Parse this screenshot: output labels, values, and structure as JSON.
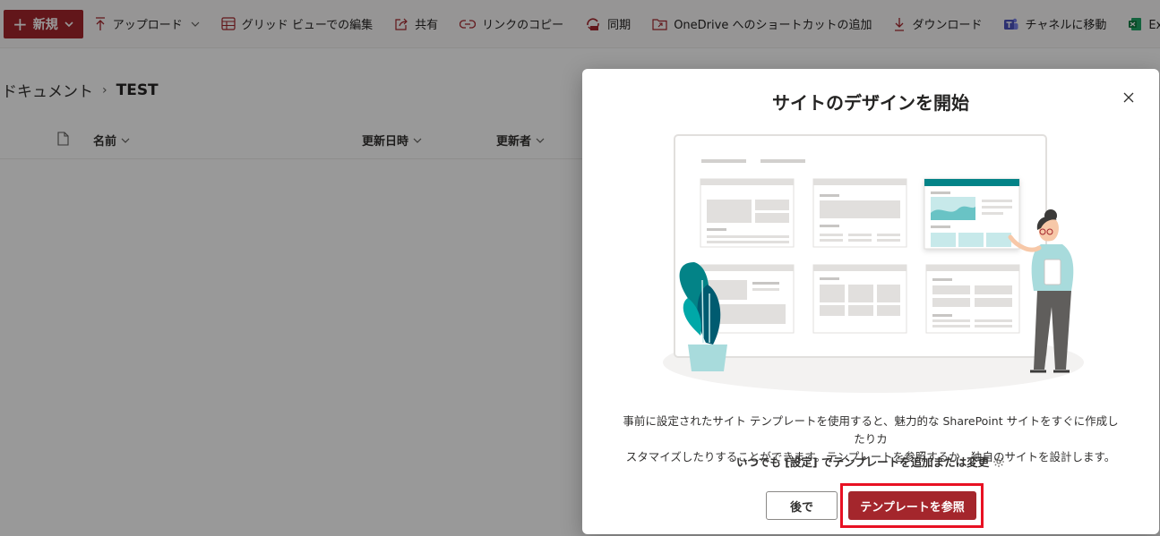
{
  "toolbar": {
    "new_label": "新規",
    "items": [
      {
        "label": "アップロード",
        "icon": "upload-icon"
      },
      {
        "label": "グリッド ビューでの編集",
        "icon": "grid-icon"
      },
      {
        "label": "共有",
        "icon": "share-icon"
      },
      {
        "label": "リンクのコピー",
        "icon": "link-icon"
      },
      {
        "label": "同期",
        "icon": "sync-icon"
      },
      {
        "label": "OneDrive へのショートカットの追加",
        "icon": "shortcut-icon"
      },
      {
        "label": "ダウンロード",
        "icon": "download-icon"
      },
      {
        "label": "チャネルに移動",
        "icon": "teams-icon"
      },
      {
        "label": "Excel にエクスポート",
        "icon": "excel-icon"
      }
    ]
  },
  "breadcrumb": {
    "root": "ドキュメント",
    "current": "TEST"
  },
  "columns": {
    "name": "名前",
    "modified": "更新日時",
    "modified_by": "更新者"
  },
  "dialog": {
    "title": "サイトのデザインを開始",
    "description_line1": "事前に設定されたサイト テンプレートを使用すると、魅力的な SharePoint サイトをすぐに作成したりカ",
    "description_line2": "スタマイズしたりすることができます。テンプレートを参照するか、独自のサイトを設計します。",
    "settings_hint": "いつでも [設定] でテンプレートを追加または変更",
    "later_label": "後で",
    "browse_label": "テンプレートを参照"
  },
  "colors": {
    "brand": "#a4262c",
    "teal": "#038387",
    "highlight": "#e81123"
  }
}
